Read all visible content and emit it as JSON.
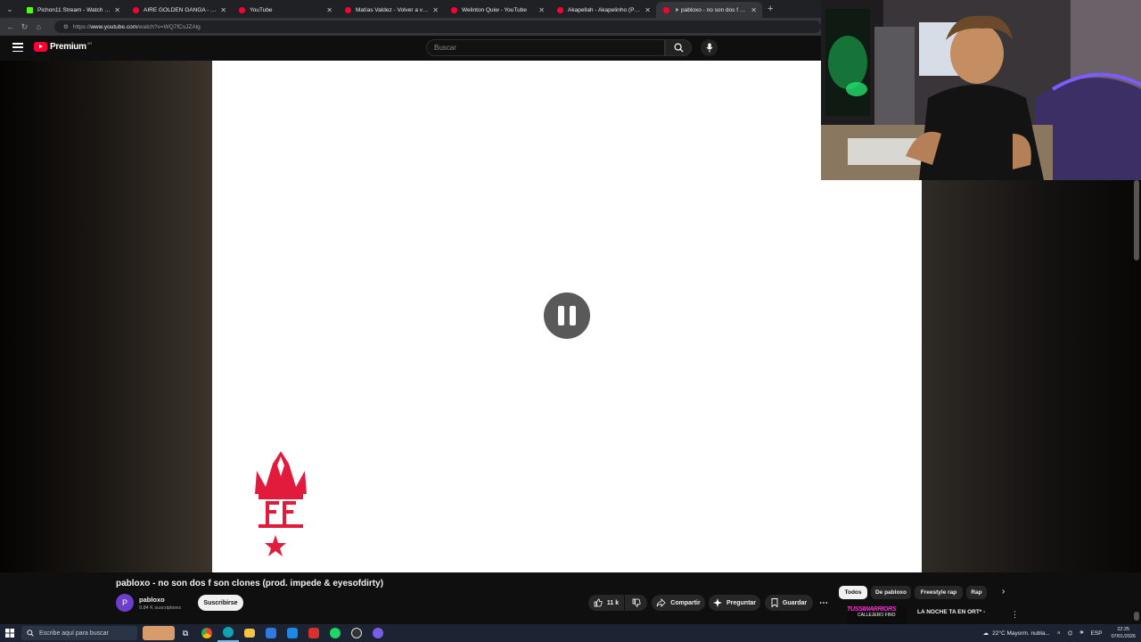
{
  "browser": {
    "tabs": [
      {
        "title": "Pichon11 Stream - Watch Live on",
        "favicon": "kick-icon",
        "active": false
      },
      {
        "title": "AIRE GOLDEN GANGA - YouTube",
        "favicon": "youtube-icon",
        "active": false
      },
      {
        "title": "YouTube",
        "favicon": "youtube-icon",
        "active": false
      },
      {
        "title": "Matías Valdez - Volver a vernos",
        "favicon": "youtube-icon",
        "active": false
      },
      {
        "title": "Welinton Quiw - YouTube",
        "favicon": "youtube-icon",
        "active": false
      },
      {
        "title": "Akapellah - Akapelinho (Prod. Ne",
        "favicon": "youtube-icon",
        "active": false
      },
      {
        "title": "pabloxo - no son dos f son cl",
        "favicon": "youtube-icon",
        "active": true
      }
    ],
    "url_prefix": "https://",
    "url_host": "www.youtube.com",
    "url_path": "/watch?v=WQ7fCsJZAlg"
  },
  "youtube": {
    "logo_text": "Premium",
    "country_code": "AR",
    "search_placeholder": "Buscar"
  },
  "video": {
    "state": "paused",
    "title": "pabloxo - no son dos f son clones (prod. impede & eyesofdirty)",
    "channel": {
      "avatar_letter": "P",
      "name": "pabloxo",
      "subscribers": "9.84 K suscriptores",
      "subscribe_label": "Suscribirse"
    },
    "actions": {
      "likes": "11 k",
      "share": "Compartir",
      "ask": "Preguntar",
      "save": "Guardar"
    }
  },
  "chips": [
    "Todos",
    "De pabloxo",
    "Freestyle rap",
    "Rap"
  ],
  "recommended": {
    "title": "LA NOCHE TA EN ORT* -",
    "thumb_text": "TUSSIWARRIORS",
    "thumb_subtext": "CALLEJERO FINO"
  },
  "taskbar": {
    "search_placeholder": "Escribe aquí para buscar",
    "weather": "22°C  Mayorm. nubla...",
    "language": "ESP",
    "time": "22:25",
    "date": "07/01/2026"
  },
  "colors": {
    "youtube_red": "#ff0033",
    "wsh_red": "#e21b3c",
    "background": "#0f0f0f"
  }
}
